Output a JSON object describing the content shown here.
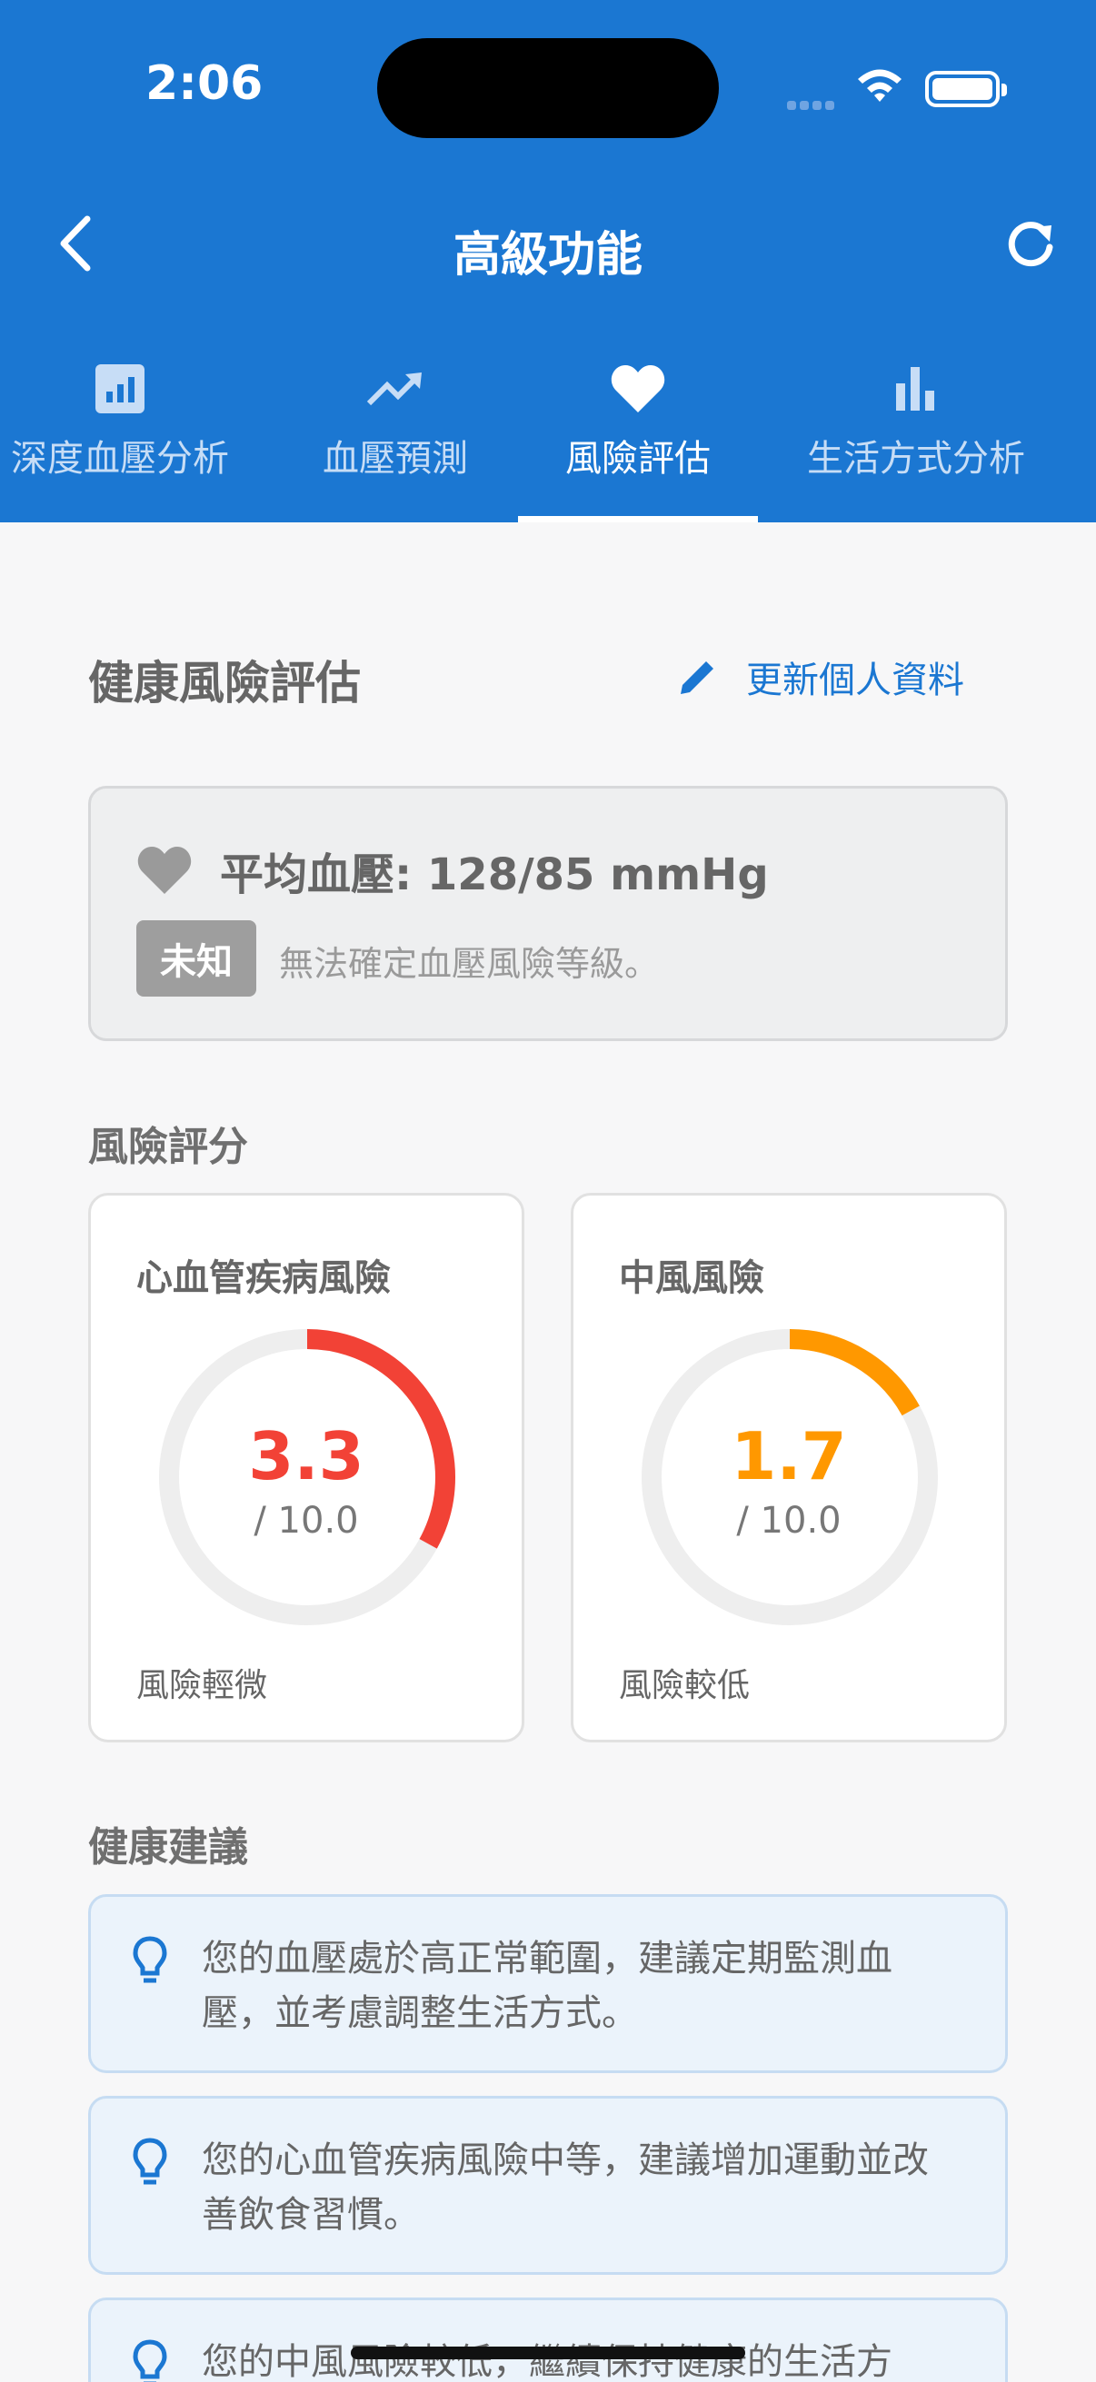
{
  "status": {
    "time": "2:06"
  },
  "header": {
    "title": "高級功能"
  },
  "tabs": [
    {
      "label": "深度血壓分析",
      "icon": "analytics-icon"
    },
    {
      "label": "血壓預測",
      "icon": "trending-up-icon"
    },
    {
      "label": "風險評估",
      "icon": "heart-icon",
      "active": true
    },
    {
      "label": "生活方式分析",
      "icon": "bar-chart-icon"
    }
  ],
  "main": {
    "title": "健康風險評估",
    "edit_label": "更新個人資料",
    "bp_summary": {
      "text": "平均血壓: 128/85 mmHg",
      "badge": "未知",
      "description": "無法確定血壓風險等級。"
    },
    "score_section_title": "風險評分",
    "scores": [
      {
        "title": "心血管疾病風險",
        "value": "3.3",
        "max": "/ 10.0",
        "fraction": 0.33,
        "color": "#f24236",
        "desc": "風險輕微"
      },
      {
        "title": "中風風險",
        "value": "1.7",
        "max": "/ 10.0",
        "fraction": 0.17,
        "color": "#ff9800",
        "desc": "風險較低"
      }
    ],
    "advice_title": "健康建議",
    "advice": [
      "您的血壓處於高正常範圍，建議定期監測血壓，並考慮調整生活方式。",
      "您的心血管疾病風險中等，建議增加運動並改善飲食習慣。",
      "您的中風風險較低，繼續保持健康的生活方"
    ]
  },
  "colors": {
    "primary": "#1b77d2",
    "risk_red": "#f24236",
    "risk_orange": "#ff9800"
  }
}
